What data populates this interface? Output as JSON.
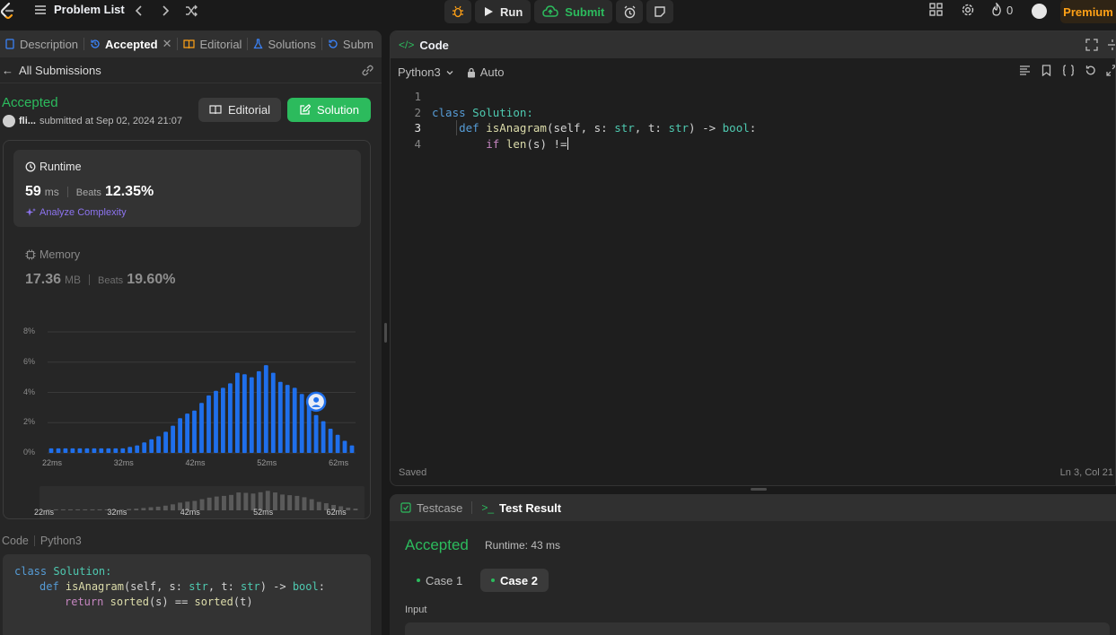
{
  "topbar": {
    "problem_list": "Problem List",
    "run": "Run",
    "submit": "Submit",
    "streak": "0",
    "premium": "Premium"
  },
  "left_tabs": [
    {
      "label": "Description"
    },
    {
      "label": "Accepted"
    },
    {
      "label": "Editorial"
    },
    {
      "label": "Solutions"
    },
    {
      "label": "Subm"
    }
  ],
  "submission": {
    "all_submissions": "All Submissions",
    "status": "Accepted",
    "user": "fli...",
    "submitted_at": "submitted at Sep 02, 2024 21:07",
    "editorial_btn": "Editorial",
    "solution_btn": "Solution"
  },
  "runtime": {
    "label": "Runtime",
    "value": "59",
    "unit": "ms",
    "beats_label": "Beats",
    "beats": "12.35%",
    "analyze": "Analyze Complexity"
  },
  "memory": {
    "label": "Memory",
    "value": "17.36",
    "unit": "MB",
    "beats_label": "Beats",
    "beats": "19.60%"
  },
  "chart_data": {
    "type": "bar",
    "x_ticks": [
      "22ms",
      "32ms",
      "42ms",
      "52ms",
      "62ms"
    ],
    "y_ticks": [
      "0%",
      "2%",
      "4%",
      "6%",
      "8%"
    ],
    "ylim": [
      0,
      8
    ],
    "xlim": [
      22,
      65
    ],
    "bar_color": "#1f6feb",
    "user_marker_ms": 59,
    "x": [
      22,
      23,
      24,
      25,
      26,
      27,
      28,
      29,
      30,
      31,
      32,
      33,
      34,
      35,
      36,
      37,
      38,
      39,
      40,
      41,
      42,
      43,
      44,
      45,
      46,
      47,
      48,
      49,
      50,
      51,
      52,
      53,
      54,
      55,
      56,
      57,
      58,
      59,
      60,
      61,
      62,
      63,
      64
    ],
    "values": [
      0.3,
      0.3,
      0.3,
      0.3,
      0.3,
      0.3,
      0.3,
      0.3,
      0.3,
      0.3,
      0.3,
      0.4,
      0.5,
      0.7,
      0.9,
      1.1,
      1.4,
      1.8,
      2.3,
      2.6,
      2.8,
      3.3,
      3.8,
      4.1,
      4.3,
      4.6,
      5.3,
      5.2,
      5.0,
      5.4,
      5.8,
      5.3,
      4.7,
      4.5,
      4.3,
      3.9,
      3.3,
      2.5,
      2.1,
      1.6,
      1.2,
      0.8,
      0.5
    ]
  },
  "left_code": {
    "header": "Code",
    "lang": "Python3",
    "line1_kw": "class",
    "line1_name": "Solution:",
    "line2_kw": "def",
    "line2_fn": "isAnagram",
    "line2_a": "(self, s: ",
    "line2_t1": "str",
    "line2_b": ", t: ",
    "line2_t2": "str",
    "line2_c": ") -> ",
    "line2_t3": "bool",
    "line2_d": ":",
    "line3_kw": "return",
    "line3_fn1": "sorted",
    "line3_a": "(s) == ",
    "line3_fn2": "sorted",
    "line3_b": "(t)"
  },
  "editor": {
    "title": "Code",
    "lang": "Python3",
    "mode": "Auto",
    "line_numbers": [
      "1",
      "2",
      "3",
      "4"
    ],
    "l1_kw": "class",
    "l1_name": "Solution:",
    "l2_kw": "def",
    "l2_fn": "isAnagram",
    "l2_a": "(self, s: ",
    "l2_t1": "str",
    "l2_b": ", t: ",
    "l2_t2": "str",
    "l2_c": ") -> ",
    "l2_t3": "bool",
    "l2_d": ":",
    "l3_kw": "if",
    "l3_fn": "len",
    "l3_a": "(s) !=",
    "saved": "Saved",
    "cursor": "Ln 3, Col 21"
  },
  "result": {
    "testcase_tab": "Testcase",
    "result_tab": "Test Result",
    "status": "Accepted",
    "runtime": "Runtime: 43 ms",
    "case1": "Case 1",
    "case2": "Case 2",
    "input_label": "Input"
  }
}
